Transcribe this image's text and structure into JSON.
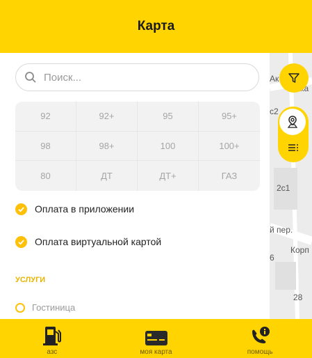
{
  "header": {
    "title": "Карта"
  },
  "search": {
    "placeholder": "Поиск..."
  },
  "fuel_types": [
    "92",
    "92+",
    "95",
    "95+",
    "98",
    "98+",
    "100",
    "100+",
    "80",
    "ДТ",
    "ДТ+",
    "ГАЗ"
  ],
  "payment_options": [
    {
      "label": "Оплата в приложении",
      "checked": true
    },
    {
      "label": "Оплата виртуальной картой",
      "checked": true
    }
  ],
  "services": {
    "title": "УСЛУГИ",
    "items": [
      {
        "label": "Гостиница",
        "checked": false
      }
    ]
  },
  "map_labels": [
    "Ак",
    "ка",
    "с2",
    "2с1",
    "й пер.",
    "Корп",
    "6",
    "28"
  ],
  "tabs": [
    {
      "label": "азс",
      "icon": "fuel-pump-icon"
    },
    {
      "label": "моя карта",
      "icon": "card-icon"
    },
    {
      "label": "помощь",
      "icon": "help-phone-icon"
    }
  ],
  "colors": {
    "accent": "#FFD400",
    "check": "#FFC107",
    "section": "#E8B400"
  }
}
